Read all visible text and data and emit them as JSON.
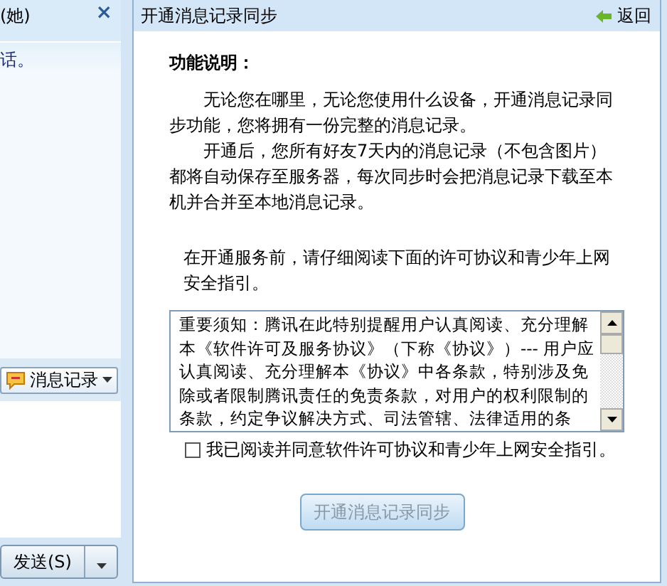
{
  "chat_pane": {
    "title": "(她)",
    "close_glyph": "×",
    "message": "话。",
    "history_button": {
      "label": "消息记录"
    },
    "send_button": {
      "label": "发送(S)"
    }
  },
  "sync_panel": {
    "title": "开通消息记录同步",
    "back_link": "返回",
    "heading": "功能说明：",
    "paragraphs": [
      "无论您在哪里，无论您使用什么设备，开通消息记录同步功能，您将拥有一份完整的消息记录。",
      "开通后，您所有好友7天内的消息记录（不包含图片）都将自动保存至服务器，每次同步时会把消息记录下载至本机并合并至本地消息记录。"
    ],
    "notice": "在开通服务前，请仔细阅读下面的许可协议和青少年上网安全指引。",
    "license_text": "重要须知：腾讯在此特别提醒用户认真阅读、充分理解本《软件许可及服务协议》（下称《协议》）--- 用户应认真阅读、充分理解本《协议》中各条款，特别涉及免除或者限制腾讯责任的免责条款，对用户的权利限制的条款，约定争议解决方式、司法管辖、法律适用的条",
    "agree": {
      "label": "我已阅读并同意软件许可协议和青少年上网安全指引。",
      "checked": false
    },
    "enable_button": {
      "label": "开通消息记录同步",
      "disabled": true
    }
  }
}
